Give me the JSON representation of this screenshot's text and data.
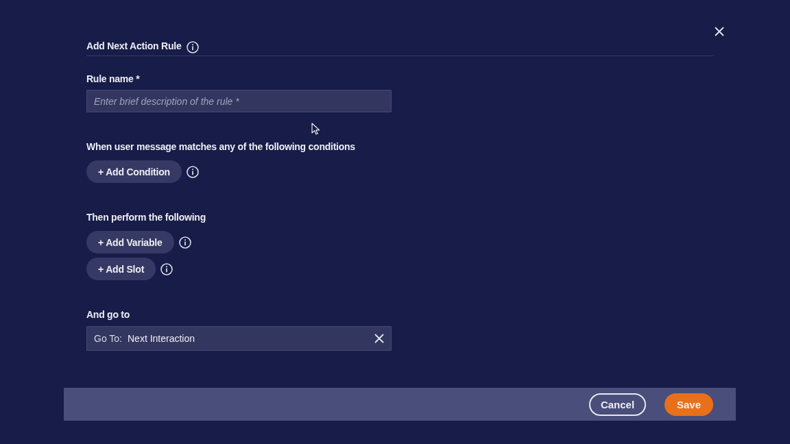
{
  "dialog": {
    "title": "Add Next Action Rule"
  },
  "rule_name": {
    "label": "Rule name *",
    "placeholder": "Enter brief description of the rule *"
  },
  "sections": [
    {
      "heading": "When user message matches any of the following conditions",
      "buttons": [
        {
          "label": "+ Add Condition"
        }
      ]
    },
    {
      "heading": "Then perform the following",
      "buttons": [
        {
          "label": "+ Add Variable"
        },
        {
          "label": "+ Add Slot"
        }
      ]
    }
  ],
  "go_to": {
    "label": "And go to",
    "prefix": "Go To:",
    "value": "Next Interaction"
  },
  "footer": {
    "buttons": [
      {
        "label": "Cancel",
        "kind": "secondary"
      },
      {
        "label": "Save",
        "kind": "primary"
      }
    ]
  }
}
